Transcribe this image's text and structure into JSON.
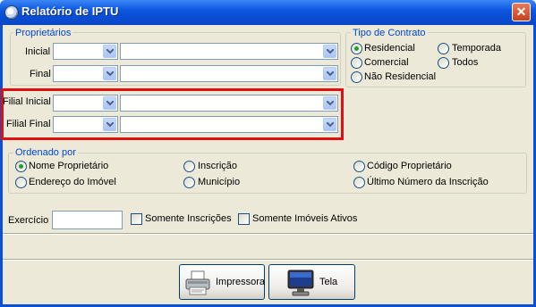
{
  "window": {
    "title": "Relatório de IPTU",
    "close_label": "✕"
  },
  "proprietarios": {
    "legend": "Proprietários",
    "inicial_label": "Inicial",
    "final_label": "Final"
  },
  "tipo_contrato": {
    "legend": "Tipo de Contrato",
    "options": [
      "Residencial",
      "Temporada",
      "Comercial",
      "Todos",
      "Não Residencial"
    ],
    "selected": "Residencial"
  },
  "filial": {
    "inicial_label": "Filial Inicial",
    "final_label": "Filial Final"
  },
  "ordenado_por": {
    "legend": "Ordenado por",
    "options": [
      "Nome Proprietário",
      "Inscrição",
      "Código Proprietário",
      "Endereço do Imóvel",
      "Município",
      "Último Número da Inscrição"
    ],
    "selected": "Nome Proprietário"
  },
  "exercicio": {
    "label": "Exercício",
    "value": "",
    "somente_inscricoes": "Somente Inscrições",
    "somente_imoveis_ativos": "Somente Imóveis Ativos"
  },
  "buttons": {
    "impressora": "Impressora",
    "tela": "Tela"
  },
  "colors": {
    "title_bar": "#0a4fd8",
    "group_legend": "#0046d5",
    "highlight": "#e01010",
    "dialog_bg": "#ece9d8"
  }
}
